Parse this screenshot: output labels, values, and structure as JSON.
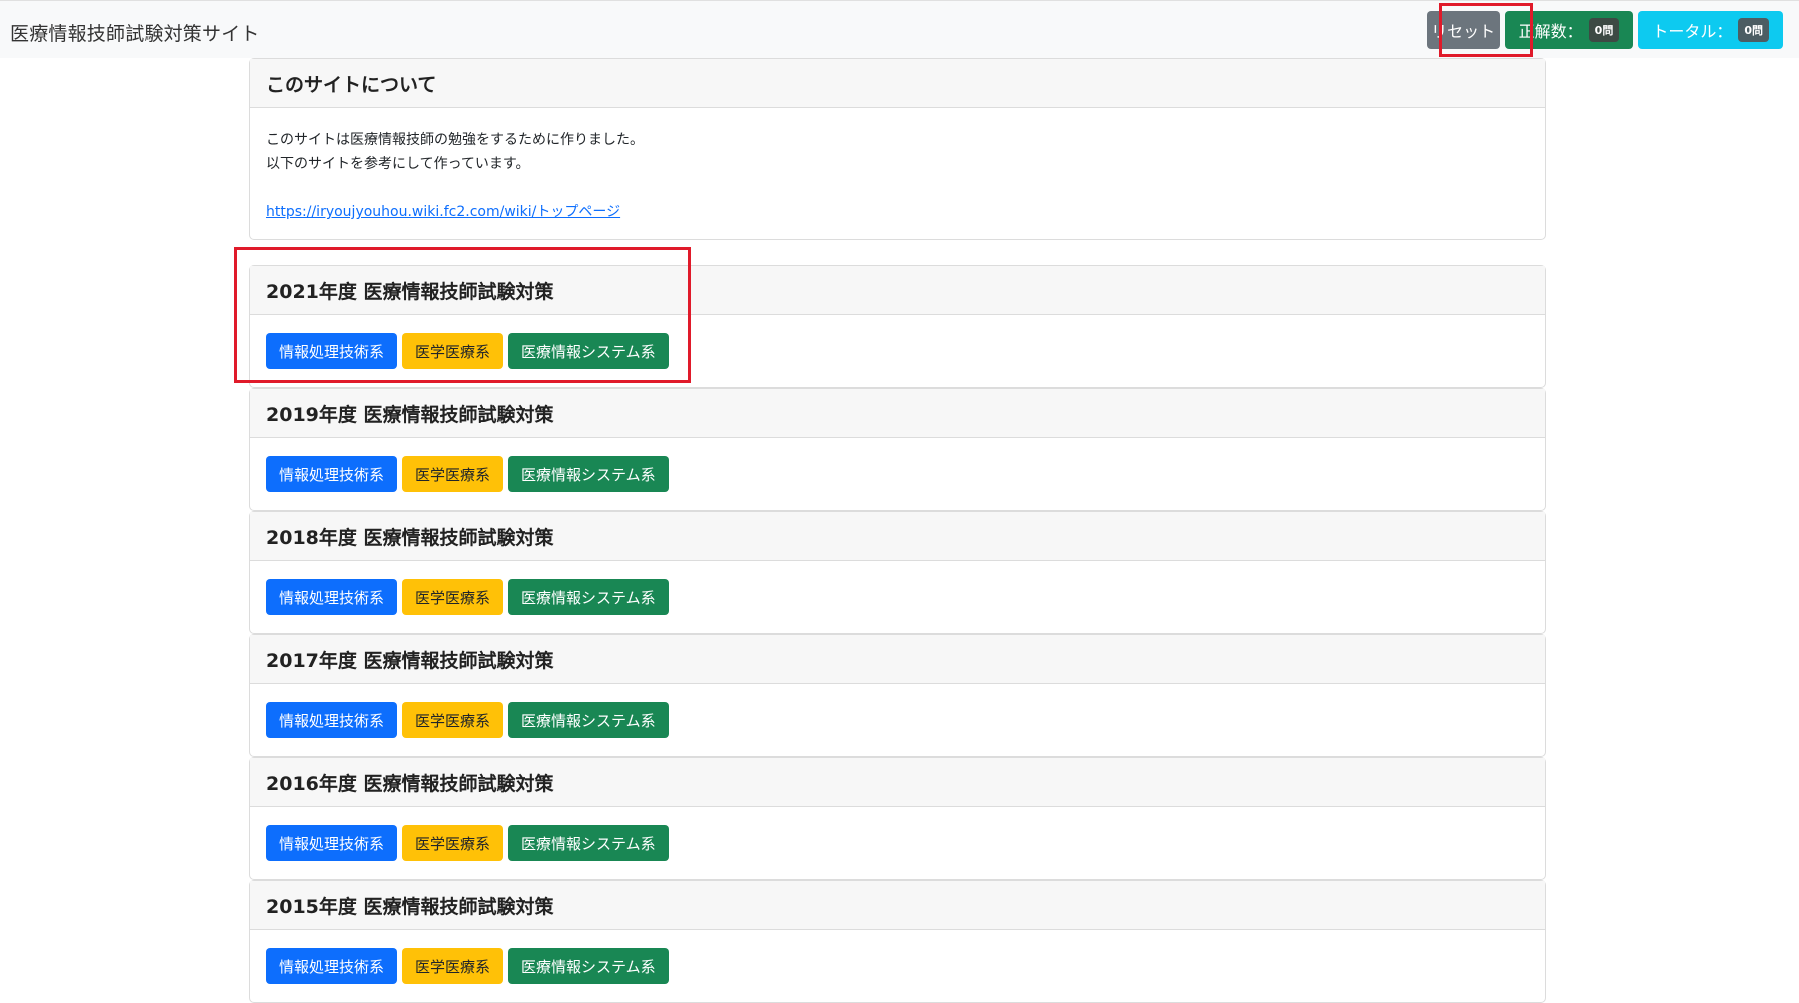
{
  "navbar": {
    "brand": "医療情報技師試験対策サイト",
    "reset_label": "リセット",
    "correct_label": "正解数：",
    "correct_count": "0問",
    "total_label": "トータル：",
    "total_count": "0問"
  },
  "about": {
    "title": "このサイトについて",
    "line1": "このサイトは医療情報技師の勉強をするために作りました。",
    "line2": "以下のサイトを参考にして作っています。",
    "link": "https://iryoujyouhou.wiki.fc2.com/wiki/トップページ"
  },
  "years": [
    {
      "title": "2021年度 医療情報技師試験対策",
      "btn1": "情報処理技術系",
      "btn2": "医学医療系",
      "btn3": "医療情報システム系"
    },
    {
      "title": "2019年度 医療情報技師試験対策",
      "btn1": "情報処理技術系",
      "btn2": "医学医療系",
      "btn3": "医療情報システム系"
    },
    {
      "title": "2018年度 医療情報技師試験対策",
      "btn1": "情報処理技術系",
      "btn2": "医学医療系",
      "btn3": "医療情報システム系"
    },
    {
      "title": "2017年度 医療情報技師試験対策",
      "btn1": "情報処理技術系",
      "btn2": "医学医療系",
      "btn3": "医療情報システム系"
    },
    {
      "title": "2016年度 医療情報技師試験対策",
      "btn1": "情報処理技術系",
      "btn2": "医学医療系",
      "btn3": "医療情報システム系"
    },
    {
      "title": "2015年度 医療情報技師試験対策",
      "btn1": "情報処理技術系",
      "btn2": "医学医療系",
      "btn3": "医療情報システム系"
    }
  ],
  "colors": {
    "primary": "#0d6efd",
    "warning": "#ffc107",
    "success": "#198754",
    "info": "#0dcaf0",
    "secondary": "#6c757d",
    "highlight": "#e01a2a"
  }
}
